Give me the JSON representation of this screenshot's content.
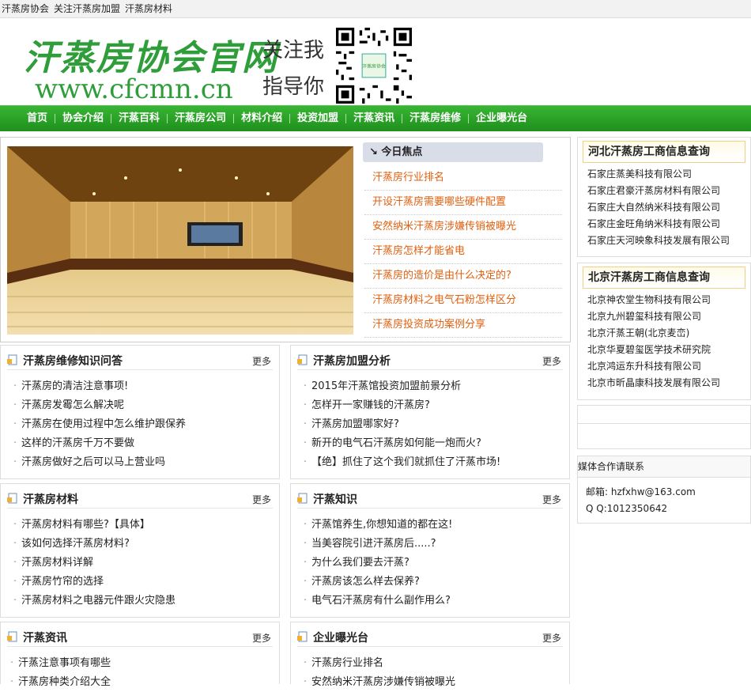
{
  "topbar": {
    "links": [
      "汗蒸房协会",
      "关注汗蒸房加盟",
      "汗蒸房材料"
    ]
  },
  "header": {
    "logo_cn": "汗蒸房协会官网",
    "logo_url": "www.cfcmn.cn",
    "follow_line1": "关注我",
    "follow_line2": "指导你",
    "qr_center_text": "汗蒸房协会"
  },
  "nav": [
    "首页",
    "协会介绍",
    "汗蒸百科",
    "汗蒸房公司",
    "材料介绍",
    "投资加盟",
    "汗蒸资讯",
    "汗蒸房维修",
    "企业曝光台"
  ],
  "focus": {
    "heading": "今日焦点",
    "items": [
      "汗蒸房行业排名",
      "开设汗蒸房需要哪些硬件配置",
      "安然纳米汗蒸房涉嫌传销被曝光",
      "汗蒸房怎样才能省电",
      "汗蒸房的造价是由什么决定的?",
      "汗蒸房材料之电气石粉怎样区分",
      "汗蒸房投资成功案例分享"
    ]
  },
  "more_label": "更多",
  "boxes": [
    {
      "title": "汗蒸房维修知识问答",
      "items": [
        "汗蒸房的清洁注意事项!",
        "汗蒸房发霉怎么解决呢",
        "汗蒸房在使用过程中怎么维护跟保养",
        "这样的汗蒸房千万不要做",
        "汗蒸房做好之后可以马上营业吗"
      ]
    },
    {
      "title": "汗蒸房加盟分析",
      "items": [
        "2015年汗蒸馆投资加盟前景分析",
        "怎样开一家赚钱的汗蒸房?",
        "汗蒸房加盟哪家好?",
        "新开的电气石汗蒸房如何能一炮而火?",
        "【绝】抓住了这个我们就抓住了汗蒸市场!"
      ]
    },
    {
      "title": "汗蒸房材料",
      "items": [
        "汗蒸房材料有哪些?【具体】",
        "该如何选择汗蒸房材料?",
        "汗蒸房材料详解",
        "汗蒸房竹帘的选择",
        "汗蒸房材料之电器元件跟火灾隐患"
      ]
    },
    {
      "title": "汗蒸知识",
      "items": [
        " 汗蒸馆养生,你想知道的都在这!",
        "当美容院引进汗蒸房后.....?",
        "为什么我们要去汗蒸?",
        "汗蒸房该怎么样去保养?",
        "电气石汗蒸房有什么副作用么?"
      ]
    },
    {
      "title": "汗蒸资讯",
      "items": [
        "汗蒸注意事项有哪些",
        "汗蒸房种类介绍大全"
      ]
    },
    {
      "title": "企业曝光台",
      "items": [
        "汗蒸房行业排名",
        "安然纳米汗蒸房涉嫌传销被曝光"
      ]
    }
  ],
  "side": [
    {
      "title": "河北汗蒸房工商信息查询",
      "items": [
        "石家庄蒸美科技有限公司",
        "石家庄君豪汗蒸房材料有限公司",
        "石家庄大自然纳米科技有限公司",
        "石家庄金旺角纳米科技有限公司",
        "石家庄天河映象科技发展有限公司"
      ]
    },
    {
      "title": "北京汗蒸房工商信息查询",
      "items": [
        "北京神农堂生物科技有限公司",
        "北京九州碧玺科技有限公司",
        "北京汗蒸王朝(北京麦峦)",
        "北京华夏碧玺医学技术研究院",
        "北京鸿运东升科技有限公司",
        "北京市昕晶康科技发展有限公司"
      ]
    }
  ],
  "media": {
    "title": "媒体合作请联系",
    "email": "邮箱: hzfxhw@163.com",
    "qq": "Q Q:1012350642"
  },
  "colors": {
    "nav_green": "#2aa22a",
    "logo_green": "#2f9e3a",
    "focus_link": "#e06010"
  }
}
